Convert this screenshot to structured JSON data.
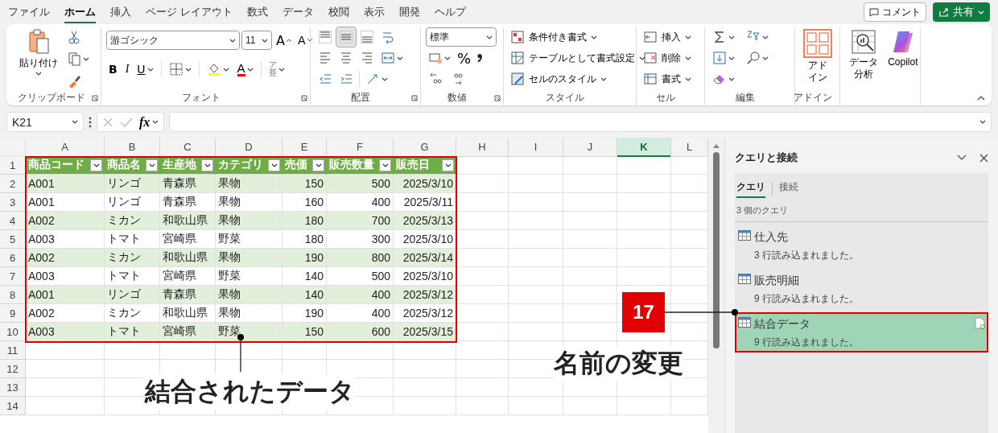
{
  "menu_tabs": [
    {
      "label": "ファイル",
      "selected": false
    },
    {
      "label": "ホーム",
      "selected": true
    },
    {
      "label": "挿入",
      "selected": false
    },
    {
      "label": "ページ レイアウト",
      "selected": false
    },
    {
      "label": "数式",
      "selected": false
    },
    {
      "label": "データ",
      "selected": false
    },
    {
      "label": "校閲",
      "selected": false
    },
    {
      "label": "表示",
      "selected": false
    },
    {
      "label": "開発",
      "selected": false
    },
    {
      "label": "ヘルプ",
      "selected": false
    }
  ],
  "top_buttons": {
    "comment": "コメント",
    "share": "共有"
  },
  "ribbon": {
    "groups": [
      {
        "label": "クリップボード",
        "buttons": [
          "貼り付け"
        ]
      },
      {
        "label": "フォント",
        "fields": [
          "游ゴシック",
          "11"
        ],
        "glyphs": [
          "A",
          "A",
          "B",
          "I",
          "U",
          "A",
          "ア亜"
        ]
      },
      {
        "label": "配置",
        "vertical_align": [
          {
            "selected": false
          },
          {
            "selected": true
          },
          {
            "selected": false
          }
        ]
      },
      {
        "label": "数値",
        "fields": [
          "標準"
        ],
        "glyphs": [
          "%"
        ]
      },
      {
        "label": "スタイル",
        "buttons": [
          "条件付き書式",
          "テーブルとして書式設定",
          "セルのスタイル"
        ]
      },
      {
        "label": "セル",
        "buttons": [
          "挿入",
          "削除",
          "書式"
        ]
      },
      {
        "label": "編集"
      },
      {
        "label": "アドイン",
        "buttons": [
          "アドイン"
        ]
      },
      {
        "buttons": [
          "データ分析",
          "Copilot"
        ]
      }
    ]
  },
  "formula_bar": {
    "name_box": "K21",
    "fx": "fx"
  },
  "sheet": {
    "columns": [
      {
        "label": "A",
        "selected": false
      },
      {
        "label": "B",
        "selected": false
      },
      {
        "label": "C",
        "selected": false
      },
      {
        "label": "D",
        "selected": false
      },
      {
        "label": "E",
        "selected": false
      },
      {
        "label": "F",
        "selected": false
      },
      {
        "label": "G",
        "selected": false
      },
      {
        "label": "H",
        "selected": false
      },
      {
        "label": "I",
        "selected": false
      },
      {
        "label": "J",
        "selected": false
      },
      {
        "label": "K",
        "selected": true
      },
      {
        "label": "L",
        "selected": false
      }
    ],
    "row_numbers": [
      "1",
      "2",
      "3",
      "4",
      "5",
      "6",
      "7",
      "8",
      "9",
      "10",
      "11",
      "12",
      "13",
      "14"
    ],
    "table": {
      "columns": [
        {
          "header": "商品コード"
        },
        {
          "header": "商品名"
        },
        {
          "header": "生産地"
        },
        {
          "header": "カテゴリ"
        },
        {
          "header": "売価"
        },
        {
          "header": "販売数量"
        },
        {
          "header": "販売日"
        }
      ],
      "rows": [
        [
          "A001",
          "リンゴ",
          "青森県",
          "果物",
          "150",
          "500",
          "2025/3/10"
        ],
        [
          "A001",
          "リンゴ",
          "青森県",
          "果物",
          "160",
          "400",
          "2025/3/11"
        ],
        [
          "A002",
          "ミカン",
          "和歌山県",
          "果物",
          "180",
          "700",
          "2025/3/13"
        ],
        [
          "A003",
          "トマト",
          "宮崎県",
          "野菜",
          "180",
          "300",
          "2025/3/10"
        ],
        [
          "A002",
          "ミカン",
          "和歌山県",
          "果物",
          "190",
          "800",
          "2025/3/14"
        ],
        [
          "A003",
          "トマト",
          "宮崎県",
          "野菜",
          "140",
          "500",
          "2025/3/10"
        ],
        [
          "A001",
          "リンゴ",
          "青森県",
          "果物",
          "140",
          "400",
          "2025/3/12"
        ],
        [
          "A002",
          "ミカン",
          "和歌山県",
          "果物",
          "190",
          "400",
          "2025/3/12"
        ],
        [
          "A003",
          "トマト",
          "宮崎県",
          "野菜",
          "150",
          "600",
          "2025/3/15"
        ]
      ]
    }
  },
  "query_panel": {
    "title": "クエリと接続",
    "tabs": [
      {
        "label": "クエリ",
        "selected": true
      },
      {
        "label": "接続",
        "selected": false
      }
    ],
    "count": "3 個のクエリ",
    "queries": [
      {
        "name": "仕入先",
        "status": "3 行読み込まれました。",
        "selected": false
      },
      {
        "name": "販売明細",
        "status": "9 行読み込まれました。",
        "selected": false
      },
      {
        "name": "結合データ",
        "status": "9 行読み込まれました。",
        "selected": true
      }
    ]
  },
  "callouts": {
    "table_label": "結合されたデータ",
    "step_number": "17",
    "step_label": "名前の変更"
  }
}
